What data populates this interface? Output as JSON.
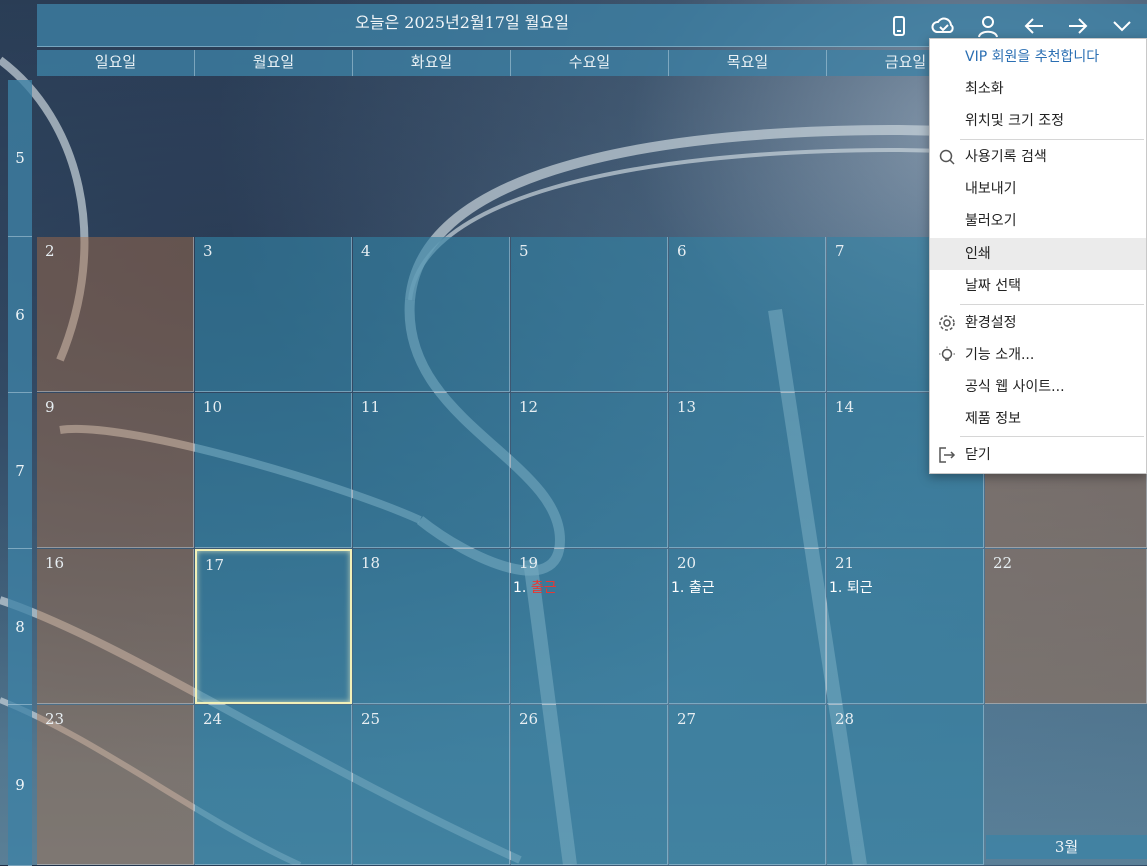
{
  "header": {
    "title": "오늘은 2025년2월17일 월요일",
    "icons": [
      "phone-icon",
      "cloud-check-icon",
      "user-icon",
      "arrow-left-icon",
      "arrow-right-icon",
      "chevron-down-icon"
    ]
  },
  "weekdays": [
    "일요일",
    "월요일",
    "화요일",
    "수요일",
    "목요일",
    "금요일"
  ],
  "weeknums": [
    "5",
    "6",
    "7",
    "8",
    "9"
  ],
  "weeks": [
    [
      "2",
      "3",
      "4",
      "5",
      "6",
      "7",
      ""
    ],
    [
      "9",
      "10",
      "11",
      "12",
      "13",
      "14",
      ""
    ],
    [
      "16",
      "17",
      "18",
      "19",
      "20",
      "21",
      "22"
    ],
    [
      "23",
      "24",
      "25",
      "26",
      "27",
      "28",
      ""
    ]
  ],
  "events": {
    "e19": {
      "num": "1. ",
      "text": "출근",
      "color": "#e53935"
    },
    "e20": {
      "num": "1. ",
      "text": "출근"
    },
    "e21": {
      "num": "1. ",
      "text": "퇴근"
    }
  },
  "next_month_label": "3월",
  "menu": {
    "vip": "VIP 회원을 추천합니다",
    "minimize": "최소화",
    "position_size": "위치및 크기 조정",
    "search_history": "사용기록 검색",
    "export": "내보내기",
    "import": "불러오기",
    "print": "인쇄",
    "date_select": "날짜 선택",
    "settings": "환경설정",
    "features": "기능 소개...",
    "website": "공식 웹 사이트...",
    "product_info": "제품 정보",
    "close": "닫기"
  },
  "colors": {
    "cell": "#3282a5",
    "weekend": "#aa6e46",
    "today_border": "#f1f0b8",
    "vip": "#2b6fb3",
    "event_red": "#e53935"
  }
}
